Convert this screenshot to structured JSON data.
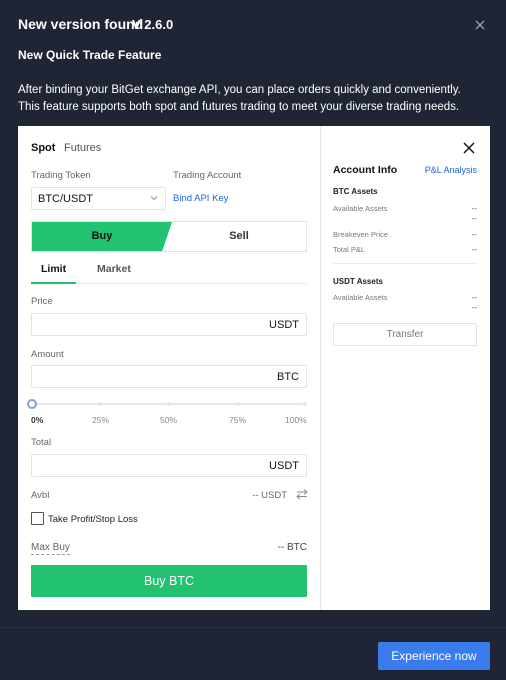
{
  "header": {
    "title": "New version found",
    "version": "V 2.6.0"
  },
  "feature": {
    "title": "New Quick Trade Feature",
    "description_line1": "After binding your BitGet exchange API, you can place orders quickly and conveniently.",
    "description_line2": "This feature supports both spot and futures trading to meet your diverse trading needs."
  },
  "trade": {
    "market_tabs": [
      "Spot",
      "Futures"
    ],
    "active_market_tab": "Spot",
    "trading_token_label": "Trading Token",
    "trading_token_value": "BTC/USDT",
    "trading_account_label": "Trading Account",
    "bind_api_label": "Bind API Key",
    "buy_label": "Buy",
    "sell_label": "Sell",
    "active_side": "Buy",
    "order_tabs": [
      "Limit",
      "Market"
    ],
    "active_order_tab": "Limit",
    "price_label": "Price",
    "price_unit": "USDT",
    "amount_label": "Amount",
    "amount_unit": "BTC",
    "slider_percent": 0,
    "slider_marks": [
      "0%",
      "25%",
      "50%",
      "75%",
      "100%"
    ],
    "total_label": "Total",
    "total_unit": "USDT",
    "avbl_label": "Avbl",
    "avbl_value": "-- USDT",
    "tpsl_label": "Take Profit/Stop Loss",
    "tpsl_checked": false,
    "max_buy_label": "Max Buy",
    "max_buy_value": "-- BTC",
    "buy_button": "Buy BTC"
  },
  "account": {
    "title": "Account Info",
    "pl_link": "P&L Analysis",
    "btc_section": "BTC Assets",
    "btc_available_label": "Available Assets",
    "btc_available_values": [
      "--",
      "--"
    ],
    "breakeven_label": "Breakeven Price",
    "breakeven_value": "--",
    "total_pl_label": "Total P&L",
    "total_pl_value": "--",
    "usdt_section": "USDT Assets",
    "usdt_available_label": "Available Assets",
    "usdt_available_values": [
      "--",
      "--"
    ],
    "transfer_button": "Transfer"
  },
  "footer": {
    "cta": "Experience now"
  },
  "colors": {
    "background": "#1f2535",
    "buy_green": "#22c271",
    "link_blue": "#1e63d6",
    "cta_blue": "#3b7ced"
  },
  "icons": [
    "close-icon",
    "panel-close-icon",
    "chevron-down-icon",
    "swap-icon",
    "checkbox"
  ]
}
